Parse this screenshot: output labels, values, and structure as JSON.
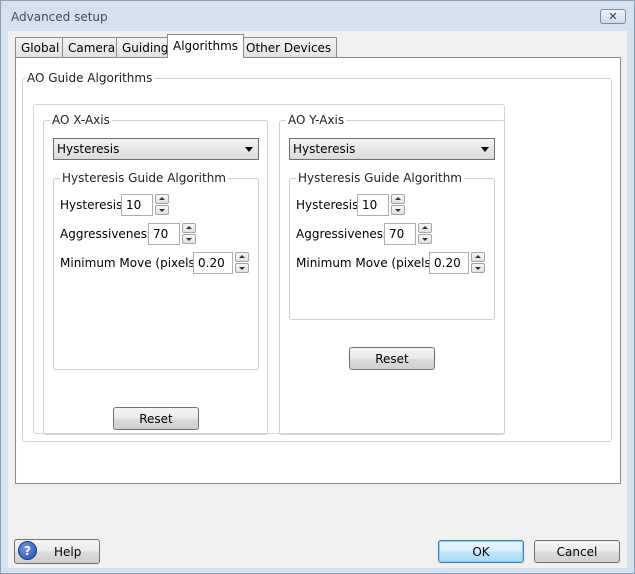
{
  "window": {
    "title": "Advanced setup",
    "close_glyph": "✕"
  },
  "tabs": [
    {
      "label": "Global"
    },
    {
      "label": "Camera"
    },
    {
      "label": "Guiding"
    },
    {
      "label": "Algorithms",
      "active": true
    },
    {
      "label": "Other Devices"
    }
  ],
  "ao_group": {
    "title": "AO Guide Algorithms"
  },
  "x_axis": {
    "title": "AO X-Axis",
    "algorithm": "Hysteresis",
    "inner_title": "Hysteresis Guide Algorithm",
    "hysteresis_label": "Hysteresis:",
    "hysteresis_value": "10",
    "aggressiveness_label": "Aggressiveness:",
    "aggressiveness_value": "70",
    "min_move_label": "Minimum Move (pixels):",
    "min_move_value": "0.20",
    "reset_label": "Reset"
  },
  "y_axis": {
    "title": "AO Y-Axis",
    "algorithm": "Hysteresis",
    "inner_title": "Hysteresis Guide Algorithm",
    "hysteresis_label": "Hysteresis:",
    "hysteresis_value": "10",
    "aggressiveness_label": "Aggressiveness:",
    "aggressiveness_value": "70",
    "min_move_label": "Minimum Move (pixels):",
    "min_move_value": "0.20",
    "reset_label": "Reset"
  },
  "footer": {
    "help_icon_glyph": "?",
    "help_label": "Help",
    "ok_label": "OK",
    "cancel_label": "Cancel"
  },
  "colors": {
    "frame": "#d5e1ee",
    "client": "#f0f0f0",
    "default_button_border": "#3c7fb1"
  },
  "icons": {
    "help": "help-question-icon",
    "close": "close-icon"
  }
}
